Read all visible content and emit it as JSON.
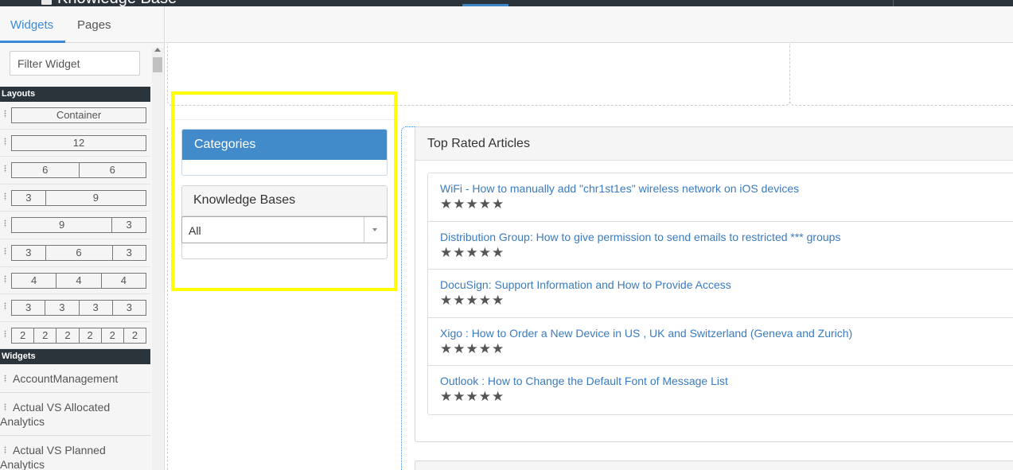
{
  "app": {
    "title": "Knowledge Base"
  },
  "sidebar": {
    "tabs": [
      {
        "label": "Widgets",
        "active": true
      },
      {
        "label": "Pages",
        "active": false
      }
    ],
    "filter": {
      "placeholder": "Filter Widget",
      "value": ""
    },
    "layouts_header": "Layouts",
    "layouts": [
      [
        "Container"
      ],
      [
        "12"
      ],
      [
        "6",
        "6"
      ],
      [
        "3",
        "9"
      ],
      [
        "9",
        "3"
      ],
      [
        "3",
        "6",
        "3"
      ],
      [
        "4",
        "4",
        "4"
      ],
      [
        "3",
        "3",
        "3",
        "3"
      ],
      [
        "2",
        "2",
        "2",
        "2",
        "2",
        "2"
      ]
    ],
    "widgets_header": "Widgets",
    "widgets": [
      "AccountManagement",
      "Actual VS Allocated Analytics",
      "Actual VS Planned Analytics"
    ]
  },
  "canvas": {
    "categories": {
      "title": "Categories"
    },
    "knowledge_bases": {
      "title": "Knowledge Bases",
      "selected": "All"
    },
    "top_rated": {
      "title": "Top Rated Articles",
      "articles": [
        {
          "title": "WiFi - How to manually add \"chr1st1es\" wireless network on iOS devices",
          "stars": "★★★★★"
        },
        {
          "title": "Distribution Group: How to give permission to send emails to restricted *** groups",
          "stars": "★★★★★"
        },
        {
          "title": "DocuSign: Support Information and How to Provide Access",
          "stars": "★★★★★"
        },
        {
          "title": "Xigo : How to Order a New Device in US , UK and Switzerland (Geneva and Zurich)",
          "stars": "★★★★★"
        },
        {
          "title": "Outlook : How to Change the Default Font of Message List",
          "stars": "★★★★★"
        }
      ]
    }
  },
  "colors": {
    "accent": "#3b8ad9",
    "panel_header_blue": "#428bca",
    "dark_header": "#2b333b",
    "highlight": "#ffff00",
    "link": "#3a7bbf"
  }
}
